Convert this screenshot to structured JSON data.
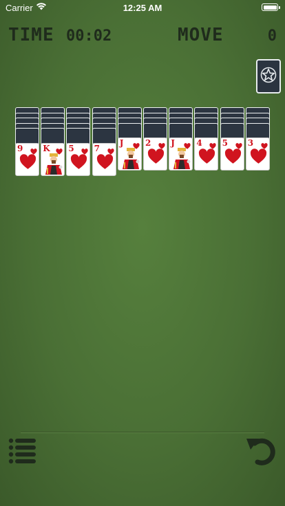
{
  "status_bar": {
    "carrier": "Carrier",
    "time": "12:25 AM"
  },
  "hud": {
    "time_label": "TIME",
    "time_value": "00:02",
    "move_label": "MOVE",
    "move_value": "0"
  },
  "colors": {
    "felt": "#4a6e35",
    "card_back": "#2c3541",
    "heart_red": "#d0141f",
    "hud_text": "#1f2b1c"
  },
  "tableau": {
    "columns": [
      {
        "face_down": 5,
        "top_card": {
          "rank": "9",
          "suit": "heart",
          "court": false
        }
      },
      {
        "face_down": 5,
        "top_card": {
          "rank": "K",
          "suit": "heart",
          "court": true
        }
      },
      {
        "face_down": 5,
        "top_card": {
          "rank": "5",
          "suit": "heart",
          "court": false
        }
      },
      {
        "face_down": 5,
        "top_card": {
          "rank": "7",
          "suit": "heart",
          "court": false
        }
      },
      {
        "face_down": 4,
        "top_card": {
          "rank": "J",
          "suit": "heart",
          "court": true
        }
      },
      {
        "face_down": 4,
        "top_card": {
          "rank": "2",
          "suit": "heart",
          "court": false
        }
      },
      {
        "face_down": 4,
        "top_card": {
          "rank": "J",
          "suit": "heart",
          "court": true
        }
      },
      {
        "face_down": 4,
        "top_card": {
          "rank": "4",
          "suit": "heart",
          "court": false
        }
      },
      {
        "face_down": 4,
        "top_card": {
          "rank": "5",
          "suit": "heart",
          "court": false
        }
      },
      {
        "face_down": 4,
        "top_card": {
          "rank": "3",
          "suit": "heart",
          "court": false
        }
      }
    ]
  },
  "icons": {
    "menu": "list-icon",
    "undo": "undo-icon",
    "star": "star-icon"
  }
}
